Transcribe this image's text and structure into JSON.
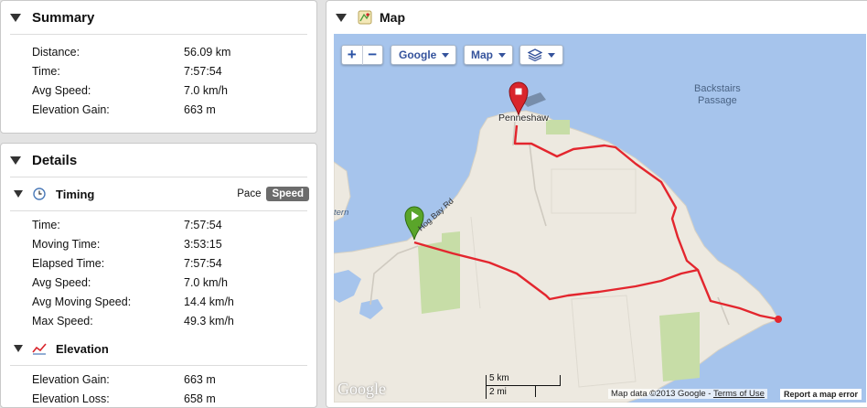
{
  "summary": {
    "title": "Summary",
    "rows": [
      {
        "label": "Distance:",
        "value": "56.09 km"
      },
      {
        "label": "Time:",
        "value": "7:57:54"
      },
      {
        "label": "Avg Speed:",
        "value": "7.0 km/h"
      },
      {
        "label": "Elevation Gain:",
        "value": "663 m"
      }
    ]
  },
  "details": {
    "title": "Details",
    "timing": {
      "title": "Timing",
      "toggle": [
        "Pace",
        "Speed"
      ],
      "active": "Speed",
      "rows": [
        {
          "label": "Time:",
          "value": "7:57:54"
        },
        {
          "label": "Moving Time:",
          "value": "3:53:15"
        },
        {
          "label": "Elapsed Time:",
          "value": "7:57:54"
        },
        {
          "label": "Avg Speed:",
          "value": "7.0 km/h"
        },
        {
          "label": "Avg Moving Speed:",
          "value": "14.4 km/h"
        },
        {
          "label": "Max Speed:",
          "value": "49.3 km/h"
        }
      ]
    },
    "elevation": {
      "title": "Elevation",
      "rows": [
        {
          "label": "Elevation Gain:",
          "value": "663 m"
        },
        {
          "label": "Elevation Loss:",
          "value": "658 m"
        }
      ]
    }
  },
  "map": {
    "title": "Map",
    "controls": {
      "zoom_in": "+",
      "zoom_out": "−",
      "provider": "Google",
      "type": "Map"
    },
    "labels": {
      "town": "Penneshaw",
      "passage_line1": "Backstairs",
      "passage_line2": "Passage",
      "road": "Hog Bay Rd",
      "western_partial": "tern"
    },
    "logo": "Google",
    "scale_km": "5 km",
    "scale_mi": "2 mi",
    "attribution": "Map data ©2013 Google - ",
    "terms": "Terms of Use",
    "report": "Report a map error",
    "colors": {
      "route": "#e3262e",
      "water": "#a6c4ec",
      "land": "#ede9e0",
      "park": "#c7dda7",
      "start_marker": "#5aa52a",
      "end_marker": "#d9252c"
    }
  }
}
